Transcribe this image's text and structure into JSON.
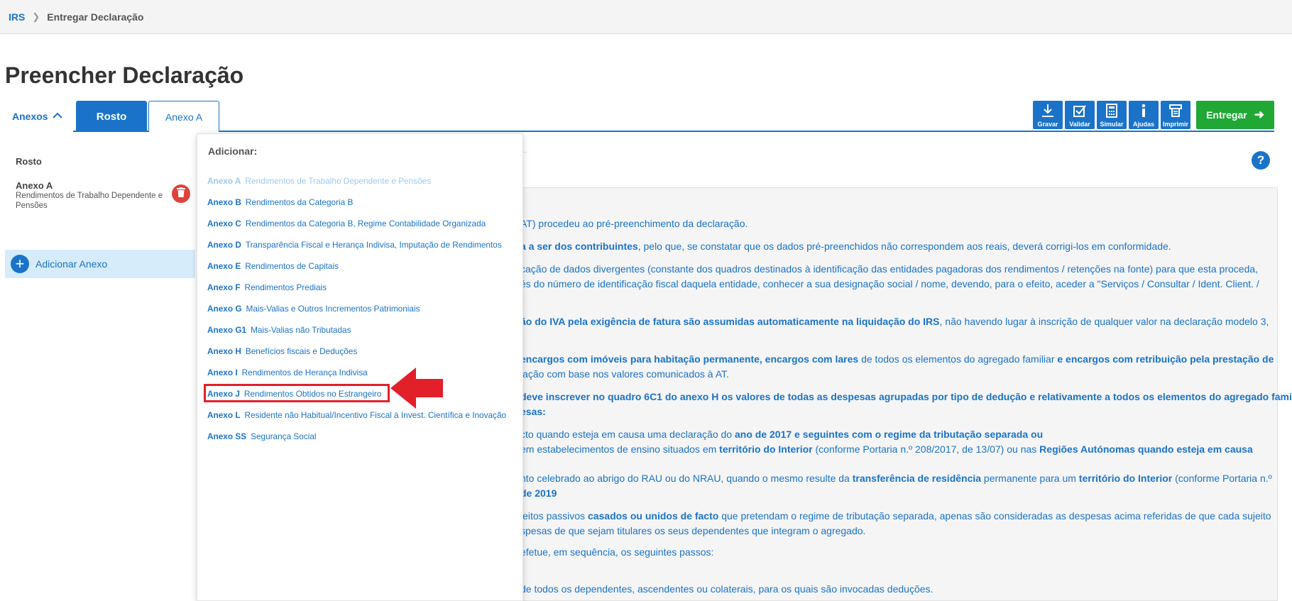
{
  "breadcrumb": {
    "root": "IRS",
    "current": "Entregar Declaração"
  },
  "page_title": "Preencher Declaração",
  "tabs": {
    "anexos": "Anexos",
    "rosto": "Rosto",
    "anexo_a": "Anexo A"
  },
  "toolbar": [
    {
      "label": "Gravar",
      "icon": "download-icon"
    },
    {
      "label": "Validar",
      "icon": "checkbox-icon"
    },
    {
      "label": "Simular",
      "icon": "calculator-icon"
    },
    {
      "label": "Ajudas",
      "icon": "info-icon"
    },
    {
      "label": "Imprimir",
      "icon": "printer-icon"
    }
  ],
  "entregar_label": "Entregar",
  "help_label": "?",
  "sidebar": {
    "rosto": "Rosto",
    "anexo_title": "Anexo A",
    "anexo_desc": "Rendimentos de Trabalho Dependente e Pensões",
    "add_label": "Adicionar Anexo"
  },
  "dropdown": {
    "header": "Adicionar:",
    "items": [
      {
        "code": "Anexo A",
        "desc": "Rendimentos de Trabalho Dependente e Pensões",
        "disabled": true
      },
      {
        "code": "Anexo B",
        "desc": "Rendimentos da Categoria B"
      },
      {
        "code": "Anexo C",
        "desc": "Rendimentos da Categoria B, Regime Contabilidade Organizada"
      },
      {
        "code": "Anexo D",
        "desc": "Transparência Fiscal e Herança Indivisa, Imputação de Rendimentos"
      },
      {
        "code": "Anexo E",
        "desc": "Rendimentos de Capitais"
      },
      {
        "code": "Anexo F",
        "desc": "Rendimentos Prediais"
      },
      {
        "code": "Anexo G",
        "desc": "Mais-Valias e Outros Incrementos Patrimoniais"
      },
      {
        "code": "Anexo G1",
        "desc": "Mais-Valias não Tributadas"
      },
      {
        "code": "Anexo H",
        "desc": "Benefícios fiscais e Deduções"
      },
      {
        "code": "Anexo I",
        "desc": "Rendimentos de Herança Indivisa"
      },
      {
        "code": "Anexo J",
        "desc": "Rendimentos Obtidos no Estrangeiro",
        "highlighted": true
      },
      {
        "code": "Anexo L",
        "desc": "Residente não Habitual/Incentivo Fiscal à Invest. Científica e Inovação"
      },
      {
        "code": "Anexo SS",
        "desc": "Segurança Social"
      }
    ]
  },
  "content": {
    "p1": "AT) procedeu ao pré-preenchimento da declaração.",
    "p2_b": "a a ser dos contribuintes",
    "p2": ", pelo que, se constatar que os dados pré-preenchidos não correspondem aos reais, deverá corrigi-los em conformidade.",
    "p3": "cação de dados divergentes (constante dos quadros destinados à identificação das entidades pagadoras dos rendimentos / retenções na fonte) para que esta proceda,",
    "p3b": "és do número de identificação fiscal daquela entidade, conhecer a sua designação social / nome, devendo, para o efeito, aceder a \"Serviços / Consultar / Ident. Client. /",
    "p4_b": "ão do IVA pela exigência de fatura são assumidas automaticamente na liquidação do IRS",
    "p4": ", não havendo lugar à inscrição de qualquer valor na declaração modelo 3,",
    "p5_b1": "encargos com imóveis para habitação permanente, encargos com lares",
    "p5": " de todos os elementos do agregado familiar ",
    "p5_b2": "e encargos com retribuição pela prestação de",
    "p5b": "lação com base nos valores comunicados à AT.",
    "p6_b": "deve inscrever no quadro 6C1 do anexo H os valores de todas as despesas agrupadas por tipo de dedução e relativamente a todos os elementos do agregado familiar",
    "p6b_b": "esas:",
    "p7": "cto quando esteja em causa uma declaração do ",
    "p7_b": "ano de 2017 e seguintes com o regime da tributação separada ou",
    "p7c": "em estabelecimentos de ensino situados em ",
    "p7c_b": "território do Interior",
    "p7d": " (conforme Portaria n.º 208/2017, de 13/07) ou nas ",
    "p7d_b": "Regiões Autónomas quando esteja em causa",
    "p8": "nto celebrado ao abrigo do RAU ou do NRAU, quando o mesmo resulte da ",
    "p8_b": "transferência de residência",
    "p8c": " permanente para um ",
    "p8c_b": "território do Interior",
    "p8d": " (conforme Portaria n.º",
    "p8e_b": "de 2019",
    "p9": "jeitos passivos ",
    "p9_b": "casados ou unidos de facto",
    "p9c": " que pretendam o regime de tributação separada, apenas são consideradas as despesas acima referidas de que cada sujeito",
    "p9d": "spesas de que sejam titulares os seus dependentes que integram o agregado.",
    "p10": "efetue, em sequência, os seguintes passos:",
    "p11": "de todos os dependentes, ascendentes ou colaterais, para os quais são invocadas deduções."
  },
  "colors": {
    "brand_blue": "#1a73c8",
    "green": "#1fa834",
    "red": "#e2202a"
  }
}
